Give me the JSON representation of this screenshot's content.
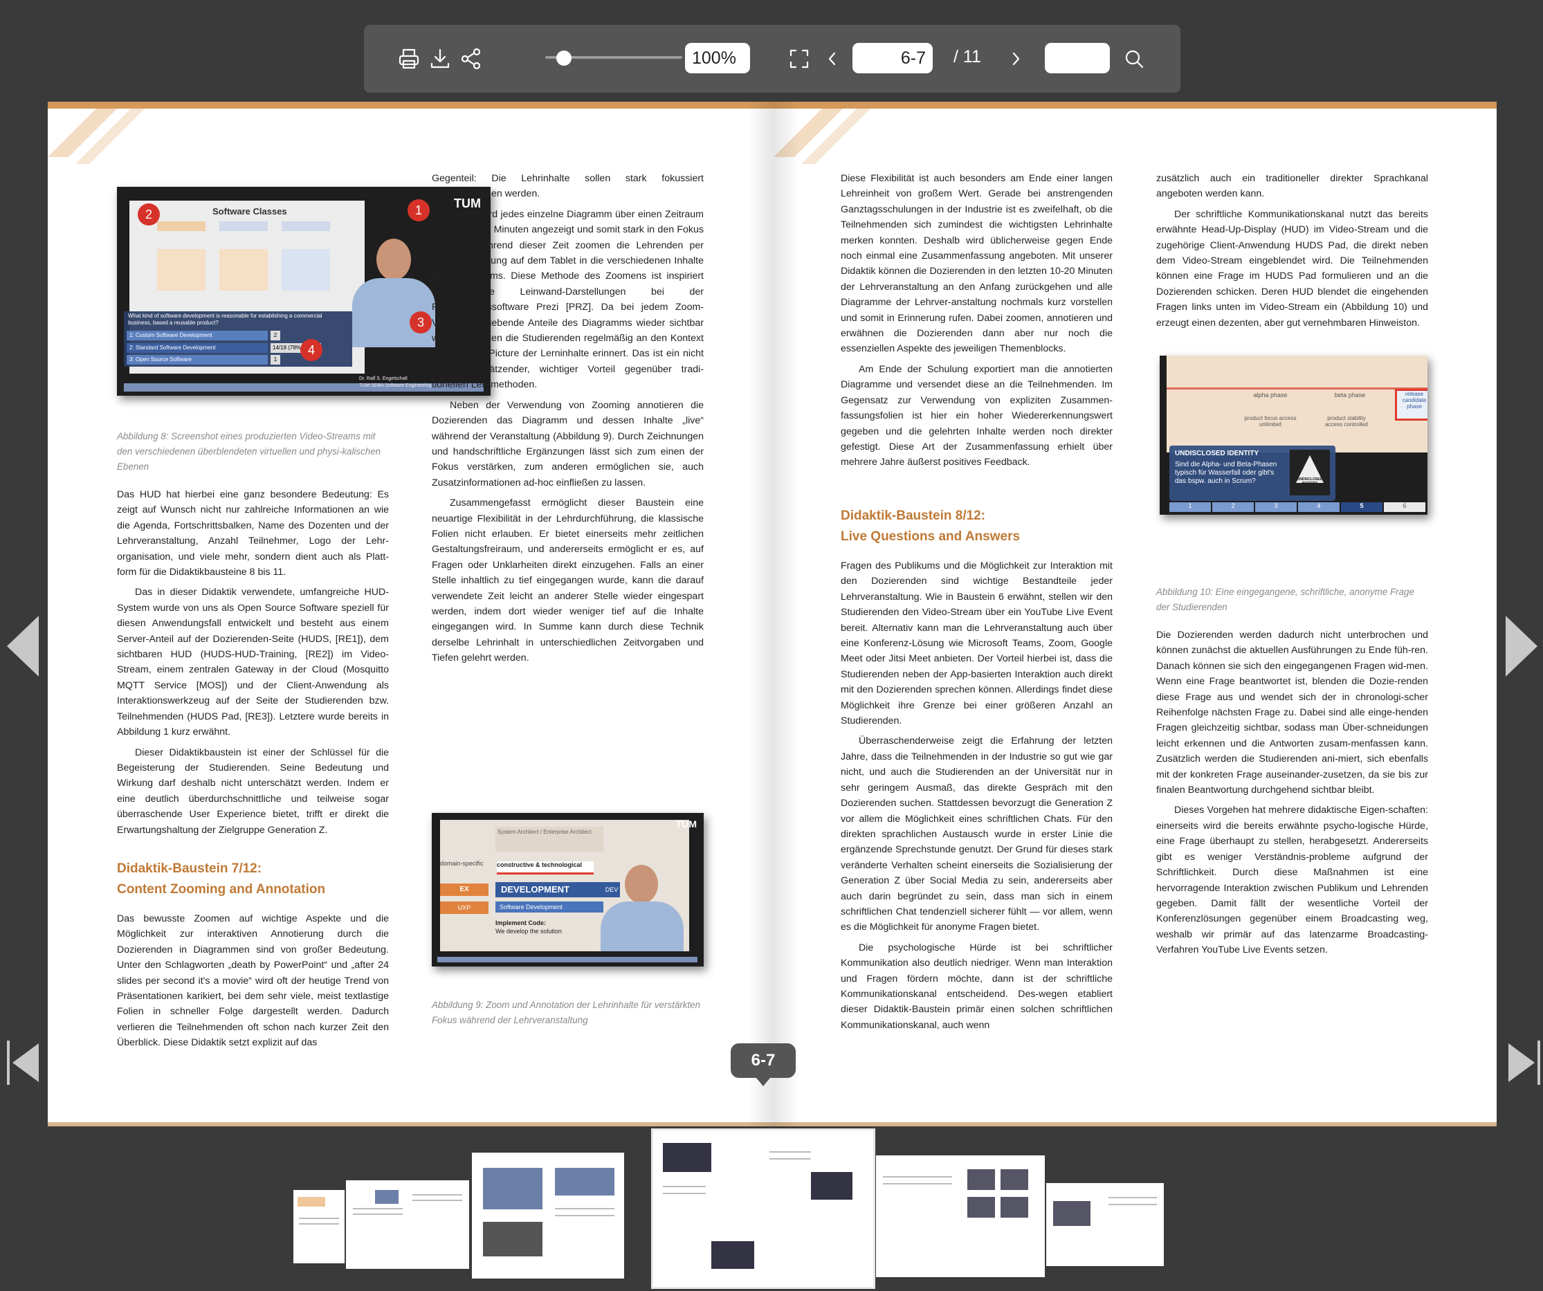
{
  "toolbar": {
    "zoom_value": "100%",
    "page_value": "6-7",
    "page_total": "/ 11",
    "search_value": "",
    "icons": [
      "print-icon",
      "download-icon",
      "share-icon",
      "fullscreen-icon",
      "chevron-left-icon",
      "chevron-right-icon",
      "search-icon"
    ]
  },
  "left_page": {
    "fig8": {
      "title": "Software Classes",
      "question": "What kind of software development is reasonable for establishing a commercial business, based a reusable product?",
      "options": [
        "1: Custom Software Development",
        "2: Standard Software Development",
        "3: Open Source Software"
      ],
      "option_values": [
        "2",
        "14/18 (78%)",
        "1"
      ],
      "markers": [
        "1",
        "2",
        "3",
        "4"
      ],
      "logo": "TUM",
      "name_tag": "Dr. Ralf S. Engelschall",
      "name_tag_sub": "TUM SEBA Software Engineering",
      "caption": "Abbildung 8: Screenshot eines produzierten Video-Streams mit den verschiedenen überblendeten virtuellen und physi-kalischen Ebenen"
    },
    "col1": [
      "Das HUD hat hierbei eine ganz besondere Bedeutung: Es zeigt auf Wunsch nicht nur zahlreiche Informationen an wie die Agenda, Fortschrittsbalken, Name des Dozenten und der Lehrveranstaltung, Anzahl Teilnehmer, Logo der Lehr-organisation, und viele mehr, sondern dient auch als Platt-form für die Didaktikbausteine 8 bis 11.",
      "Das in dieser Didaktik verwendete, umfangreiche HUD-System wurde von uns als Open Source Software speziell für diesen Anwendungsfall entwickelt und besteht aus einem Server-Anteil auf der Dozierenden-Seite (HUDS, [RE1]), dem sichtbaren HUD (HUDS-HUD-Training, [RE2]) im Video-Stream, einem zentralen Gateway in der Cloud (Mosquitto MQTT Service [MOS]) und der Client-Anwendung als Interaktionswerkzeug auf der Seite der Studierenden bzw. Teilnehmenden (HUDS Pad, [RE3]). Letztere wurde bereits in Abbildung 1 kurz erwähnt.",
      "Dieser Didaktikbaustein ist einer der Schlüssel für die Begeisterung der Studierenden. Seine Bedeutung und Wirkung darf deshalb nicht unterschätzt werden. Indem er eine deutlich überdurchschnittliche und teilweise sogar überraschende User Experience bietet, trifft er direkt die Erwartungshaltung der Zielgruppe Generation Z."
    ],
    "heading1_line1": "Didaktik-Baustein 7/12:",
    "heading1_line2": "Content Zooming and Annotation",
    "col1b": "Das bewusste Zoomen auf wichtige Aspekte und die Möglichkeit zur interaktiven Annotierung durch die Dozierenden in Diagrammen sind von großer Bedeutung. Unter den Schlagworten „death by PowerPoint“ und „after 24 slides per second it's a movie“ wird oft der heutige Trend von Präsentationen karikiert, bei dem sehr viele, meist textlastige Folien in schneller Folge dargestellt werden. Dadurch verlieren die Teilnehmenden oft schon nach kurzer Zeit den Überblick. Diese Didaktik setzt explizit auf das",
    "col2": [
      "Gegenteil: Die Lehrinhalte sollen stark fokussiert wahrgenommen werden.",
      "Daher wird jedes einzelne Diagramm über einen Zeitraum von 20 bis 40 Minuten angezeigt und somit stark in den Fokus gerückt. Während dieser Zeit zoomen die Lehrenden per Gestensteuerung auf dem Tablet in die verschiedenen Inhalte des Diagramms. Diese Methode des Zoomens ist inspiriert durch die Leinwand-Darstellungen bei der Präsentationssoftware Prezi [PRZ]. Da bei jedem Zoom-Vorgang umgebende Anteile des Diagramms wieder sichtbar werden, werden die Studierenden regelmäßig an den Kontext und das Big Picture der Lerninhalte erinnert. Das ist ein nicht zu unterschätzender, wichtiger Vorteil gegenüber tradi-tionellen Lehrmethoden.",
      "Neben der Verwendung von Zooming annotieren die Dozierenden das Diagramm und dessen Inhalte „live“ während der Veranstaltung (Abbildung 9). Durch Zeichnungen und handschriftliche Ergänzungen lässt sich zum einen der Fokus verstärken, zum anderen ermöglichen sie, auch Zusatzinformationen ad-hoc einfließen zu lassen.",
      "Zusammengefasst ermöglicht dieser Baustein eine neuartige Flexibilität in der Lehrdurchführung, die klassische Folien nicht erlauben. Er bietet einerseits mehr zeitlichen Gestaltungsfreiraum, und andererseits ermöglicht er es, auf Fragen oder Unklarheiten direkt einzugehen. Falls an einer Stelle inhaltlich zu tief eingegangen wurde, kann die darauf verwendete Zeit leicht an anderer Stelle wieder eingespart werden, indem dort wieder weniger tief auf die Inhalte eingegangen wird. In Summe kann durch diese Technik derselbe Lehrinhalt in unterschiedlichen Zeitvorgaben und Tiefen gelehrt werden."
    ],
    "fig9": {
      "labels": [
        "System Architect / Enterprise Architect",
        "domain-specific",
        "constructive & technological",
        "EX",
        "DEVELOPMENT",
        "DEV",
        "UXP",
        "Software Development",
        "Implement Code:",
        "We develop the solution"
      ],
      "logo": "TUM",
      "caption": "Abbildung 9: Zoom und Annotation der Lehrinhalte für verstärkten Fokus während der Lehrveranstaltung"
    }
  },
  "right_page": {
    "col3": [
      "Diese Flexibilität ist auch besonders am Ende einer langen Lehreinheit von großem Wert. Gerade bei anstrengenden Ganztagsschulungen in der Industrie ist es zweifelhaft, ob die Teilnehmenden sich zumindest die wichtigsten Lehrinhalte merken konnten. Deshalb wird üblicherweise gegen Ende noch einmal eine Zusammenfassung angeboten. Mit unserer Didaktik können die Dozierenden in den letzten 10-20 Minuten der Lehrveranstaltung an den Anfang zurückgehen und alle Diagramme der Lehrver-anstaltung nochmals kurz vorstellen und somit in Erinnerung rufen. Dabei zoomen, annotieren und erwähnen die Dozierenden dann aber nur noch die essenziellen Aspekte des jeweiligen Themenblocks.",
      "Am Ende der Schulung exportiert man die annotierten Diagramme und versendet diese an die Teilnehmenden. Im Gegensatz zur Verwendung von expliziten Zusammen-fassungsfolien ist hier ein hoher Wiedererkennungswert gegeben und die gelehrten Inhalte werden noch direkter gefestigt. Diese Art der Zusammenfassung erhielt über mehrere Jahre äußerst positives Feedback."
    ],
    "heading2_line1": "Didaktik-Baustein 8/12:",
    "heading2_line2": "Live Questions and Answers",
    "col3b": [
      "Fragen des Publikums und die Möglichkeit zur Interaktion mit den Dozierenden sind wichtige Bestandteile jeder Lehrveranstaltung. Wie in Baustein 6 erwähnt, stellen wir den Studierenden den Video-Stream über ein YouTube Live Event bereit. Alternativ kann man die Lehrveranstaltung auch über eine Konferenz-Lösung wie Microsoft Teams, Zoom, Google Meet oder Jitsi Meet anbieten. Der Vorteil hierbei ist, dass die Studierenden neben der App-basierten Interaktion auch direkt mit den Dozierenden sprechen können. Allerdings findet diese Möglichkeit ihre Grenze bei einer größeren Anzahl an Studierenden.",
      "Überraschenderweise zeigt die Erfahrung der letzten Jahre, dass die Teilnehmenden in der Industrie so gut wie gar nicht, und auch die Studierenden an der Universität nur in sehr geringem Ausmaß, das direkte Gespräch mit den Dozierenden suchen. Stattdessen bevorzugt die Generation Z vor allem die Möglichkeit eines schriftlichen Chats. Für den direkten sprachlichen Austausch wurde in erster Linie die ergänzende Sprechstunde genutzt. Der Grund für dieses stark veränderte Verhalten scheint einerseits die Sozialisierung der Generation Z über Social Media zu sein, andererseits aber auch darin begründet zu sein, dass man sich in einem schriftlichen Chat tendenziell sicherer fühlt — vor allem, wenn es die Möglichkeit für anonyme Fragen bietet.",
      "Die psychologische Hürde ist bei schriftlicher Kommunikation also deutlich niedriger. Wenn man Interaktion und Fragen fördern möchte, dann ist der schriftliche Kommunikationskanal entscheidend. Des-wegen etabliert dieser Didaktik-Baustein primär einen solchen schriftlichen Kommunikationskanal, auch wenn"
    ],
    "col4": [
      "zusätzlich auch ein traditioneller direkter Sprachkanal angeboten werden kann.",
      "Der schriftliche Kommunikationskanal nutzt das bereits erwähnte Head-Up-Display (HUD) im Video-Stream und die zugehörige Client-Anwendung HUDS Pad, die direkt neben dem Video-Stream eingeblendet wird. Die Teilnehmenden können eine Frage im HUDS Pad formulieren und an die Dozierenden schicken. Deren HUD blendet die eingehenden Fragen links unten im Video-Stream ein (Abbildung 10) und erzeugt einen dezenten, aber gut vernehmbaren Hinweiston."
    ],
    "fig10": {
      "labels": [
        "alpha phase",
        "beta phase",
        "release candidate phase",
        "product focus access unlimited",
        "product stability access controlled"
      ],
      "question_title": "UNDISCLOSED IDENTITY",
      "question_text": "Sind die Alpha- und Beta-Phasen typisch für Wasserfall oder gibt's das bspw. auch in Scrum?",
      "badge": "UNDISCLOSED IDENTITY",
      "progress": [
        "1",
        "2",
        "3",
        "4",
        "5",
        "6"
      ],
      "caption": "Abbildung 10: Eine eingegangene, schriftliche, anonyme Frage der Studierenden"
    },
    "col4b": [
      "Die Dozierenden werden dadurch nicht unterbrochen und können zunächst die aktuellen Ausführungen zu Ende füh-ren. Danach können sie sich den eingegangenen Fragen wid-men. Wenn eine Frage beantwortet ist, blenden die Dozie-renden diese Frage aus und wendet sich der in chronologi-scher Reihenfolge nächsten Frage zu. Dabei sind alle einge-henden Fragen gleichzeitig sichtbar, sodass man Über-schneidungen leicht erkennen und die Antworten zusam-menfassen kann. Zusätzlich werden die Studierenden ani-miert, sich ebenfalls mit der konkreten Frage auseinander-zusetzen, da sie bis zur finalen Beantwortung durchgehend sichtbar bleibt.",
      "Dieses Vorgehen hat mehrere didaktische Eigen-schaften: einerseits wird die bereits erwähnte psycho-logische Hürde, eine Frage überhaupt zu stellen, herabgesetzt. Andererseits gibt es weniger Verständnis-probleme aufgrund der Schriftlichkeit. Durch diese Maßnahmen ist eine hervorragende Interaktion zwischen Publikum und Lehrenden gegeben. Damit fällt der wesentliche Vorteil der Konferenzlösungen gegenüber einem Broadcasting weg, weshalb wir primär auf das latenzarme Broadcasting-Verfahren YouTube Live Events setzen."
    ]
  },
  "page_badge": "6-7"
}
